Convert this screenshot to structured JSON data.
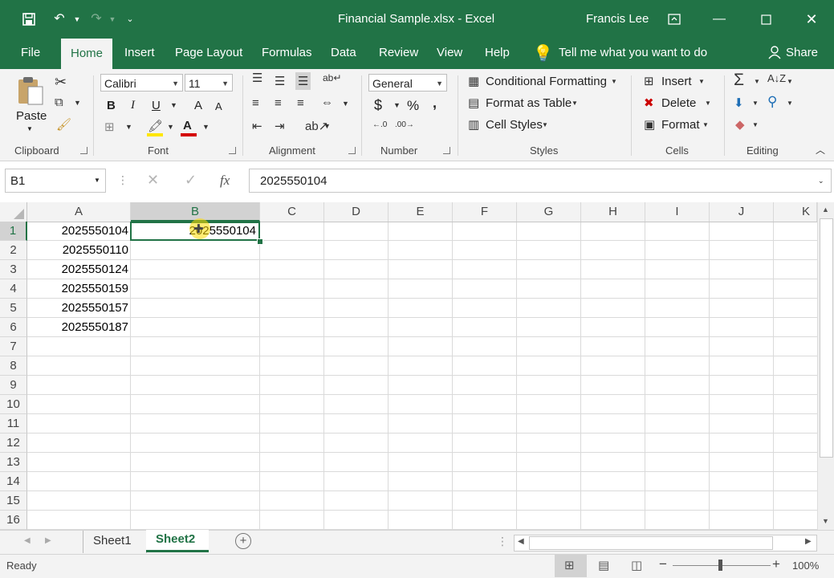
{
  "window": {
    "title": "Financial Sample.xlsx  -  Excel",
    "user": "Francis Lee"
  },
  "tabs": [
    "File",
    "Home",
    "Insert",
    "Page Layout",
    "Formulas",
    "Data",
    "Review",
    "View",
    "Help"
  ],
  "tell_me": "Tell me what you want to do",
  "share": "Share",
  "ribbon": {
    "clipboard": {
      "label": "Clipboard",
      "paste": "Paste"
    },
    "font": {
      "label": "Font",
      "name": "Calibri",
      "size": "11",
      "bold": "B",
      "italic": "I",
      "underline": "U",
      "grow": "A",
      "shrink": "A",
      "font_color": "A"
    },
    "alignment": {
      "label": "Alignment"
    },
    "number": {
      "label": "Number",
      "format": "General",
      "currency": "$",
      "percent": "%",
      "comma": ","
    },
    "styles": {
      "label": "Styles",
      "conditional": "Conditional Formatting",
      "format_table": "Format as Table",
      "cell_styles": "Cell Styles"
    },
    "cells": {
      "label": "Cells",
      "insert": "Insert",
      "delete": "Delete",
      "format": "Format"
    },
    "editing": {
      "label": "Editing"
    }
  },
  "formula_bar": {
    "name_box": "B1",
    "fx": "fx",
    "value": "2025550104"
  },
  "columns": [
    "A",
    "B",
    "C",
    "D",
    "E",
    "F",
    "G",
    "H",
    "I",
    "J",
    "K"
  ],
  "rows": [
    "1",
    "2",
    "3",
    "4",
    "5",
    "6",
    "7",
    "8",
    "9",
    "10",
    "11",
    "12",
    "13",
    "14",
    "15",
    "16"
  ],
  "cells": {
    "A": [
      "2025550104",
      "2025550110",
      "2025550124",
      "2025550159",
      "2025550157",
      "2025550187"
    ],
    "B1": "2025550104"
  },
  "sheets": [
    "Sheet1",
    "Sheet2"
  ],
  "active_sheet": "Sheet2",
  "status": {
    "ready": "Ready",
    "zoom": "100%"
  },
  "colors": {
    "accent": "#217346",
    "selection": "#217346"
  }
}
